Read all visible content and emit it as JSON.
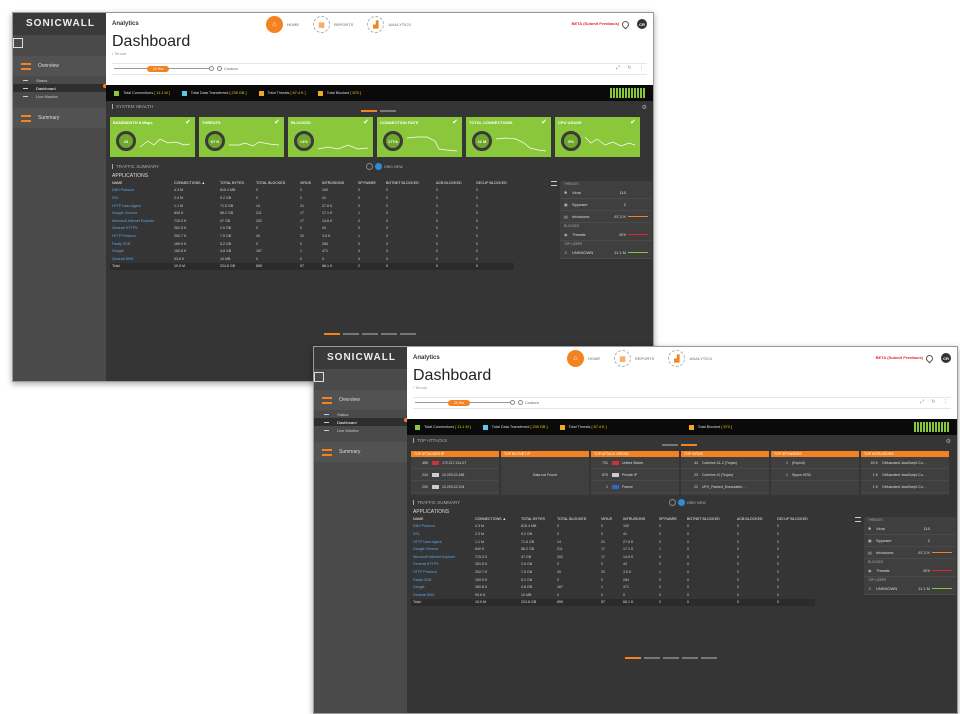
{
  "app": {
    "logo": "SONICWALL",
    "section": "Analytics",
    "title": "Dashboard",
    "breadcrumb": "/ Tenure",
    "beta": "BETA (Submit Feedback)",
    "avatar": "CR"
  },
  "tabs": [
    {
      "label": "HOME"
    },
    {
      "label": "REPORTS"
    },
    {
      "label": "ANALYTICS"
    }
  ],
  "sidebar": {
    "overview": "Overview",
    "status": "Status",
    "dashboard": "Dashboard",
    "livemonitor": "Live Monitor",
    "summary": "Summary"
  },
  "timeline": {
    "selected": "24 Hrs",
    "custom": "Custom"
  },
  "stats": [
    {
      "label": "Total Connections",
      "value": "[ 11.1 M ]",
      "color": "#8ac73a"
    },
    {
      "label": "Total Data Transferred",
      "value": "[ 239 GB ]",
      "color": "#5ec8e5"
    },
    {
      "label": "Total Threats",
      "value": "[ 67.4 K ]",
      "color": "#f5a623"
    },
    {
      "label": "Total Blocked",
      "value": "[ 870 ]",
      "color": "#f5a623"
    }
  ],
  "health": {
    "title": "SYSTEM HEALTH",
    "cards": [
      {
        "name": "BANDWIDTH 8 Mbps",
        "value": "23"
      },
      {
        "name": "THREATS",
        "value": "67 K"
      },
      {
        "name": "BLOCKED",
        "value": "<1%"
      },
      {
        "name": "CONNECTION RATE",
        "value": "177/s"
      },
      {
        "name": "TOTAL CONNECTIONS",
        "value": "11 M"
      },
      {
        "name": "CPU USAGE",
        "value": "9%"
      }
    ]
  },
  "attacks": {
    "title": "TOP ATTACKS",
    "cards": [
      {
        "name": "TOP ATTACKER IP",
        "rows": [
          {
            "n": "455",
            "t": "172.217.214.97"
          },
          {
            "n": "224",
            "t": "10.203.22.186"
          },
          {
            "n": "209",
            "t": "10.203.22.104"
          }
        ]
      },
      {
        "name": "TOP BOTNET IP",
        "empty": "Data not Found"
      },
      {
        "name": "TOP ATTACK ORIGIN",
        "rows": [
          {
            "n": "731",
            "t": "United States"
          },
          {
            "n": "870",
            "t": "Private IP"
          },
          {
            "n": "1",
            "t": "France"
          }
        ]
      },
      {
        "name": "TOP VIRUS",
        "rows": [
          {
            "n": "44",
            "t": "Coinhive.XL.2 (Trojan)"
          },
          {
            "n": "23",
            "t": "Coinhive.XI (Trojan)"
          },
          {
            "n": "22",
            "t": "UPX_Packed_Executable..."
          }
        ]
      },
      {
        "name": "TOP SPYWARES",
        "rows": [
          {
            "n": "1",
            "t": "(Exploit)"
          },
          {
            "n": "1",
            "t": "Spyon ISSD"
          }
        ]
      },
      {
        "name": "TOP INTRUSIONS",
        "rows": [
          {
            "n": "63 K",
            "t": "Obfuscated JavaScript Co..."
          },
          {
            "n": "1 K",
            "t": "Obfuscated JavaScript Co..."
          },
          {
            "n": "1 K",
            "t": "Obfuscated JavaScript Co..."
          }
        ]
      }
    ]
  },
  "traffic": {
    "title": "TRAFFIC SUMMARY",
    "apps_label": "APPLICATIONS",
    "grid_view": "GRID VIEW",
    "headers": [
      "NAME",
      "CONNECTIONS ▲",
      "TOTAL BYTES",
      "TOTAL BLOCKED",
      "VIRUS",
      "INTRUSIONS",
      "SPYWARE",
      "BOTNET BLOCKED",
      "ACB BLOCKED",
      "GEO-IP BLOCKED"
    ],
    "rows": [
      [
        "DNS Protocol",
        "4.3 M",
        "815.4 MB",
        "0",
        "0",
        "100",
        "0",
        "0",
        "0",
        "0"
      ],
      [
        "SSL",
        "2.0 M",
        "9.2 GB",
        "0",
        "0",
        "41",
        "0",
        "0",
        "0",
        "0"
      ],
      [
        "HTTP User-Agent",
        "1.1 M",
        "71.5 GB",
        "14",
        "21",
        "27.8 K",
        "0",
        "0",
        "0",
        "0"
      ],
      [
        "Google Chrome",
        "840 K",
        "56.2 GB",
        "211",
        "17",
        "17.1 K",
        "1",
        "0",
        "0",
        "0"
      ],
      [
        "Microsoft Internet Explorer",
        "715.3 K",
        "47 GB",
        "202",
        "17",
        "14.6 K",
        "0",
        "0",
        "0",
        "0"
      ],
      [
        "General HTTPS",
        "281.5 K",
        "2.6 GB",
        "0",
        "0",
        "44",
        "0",
        "0",
        "0",
        "0"
      ],
      [
        "HTTP Protocol",
        "252.7 K",
        "7.5 GB",
        "40",
        "20",
        "3.5 K",
        "1",
        "0",
        "0",
        "0"
      ],
      [
        "Fastly CDN",
        "169.9 K",
        "5.2 GB",
        "0",
        "0",
        "284",
        "0",
        "0",
        "0",
        "0"
      ],
      [
        "Google",
        "160.8 K",
        "4.8 GB",
        "167",
        "1",
        "471",
        "0",
        "0",
        "0",
        "0"
      ],
      [
        "General DNS",
        "93.6 K",
        "10 MB",
        "0",
        "0",
        "0",
        "0",
        "0",
        "0",
        "0"
      ]
    ],
    "total": [
      "Total",
      "10.9 M",
      "224.6 GB",
      "659",
      "97",
      "66.1 K",
      "2",
      "0",
      "0",
      "0"
    ]
  },
  "rightpanel": {
    "threats_head": "THREATS",
    "virus": "Virus",
    "virus_val": "110",
    "spyware": "Spyware",
    "spyware_val": "2",
    "intrusions": "Intrusions",
    "intrusions_val": "67.2 K",
    "blocked_head": "BLOCKED",
    "threats": "Threats",
    "threats_val": "870",
    "users_head": "TOP USERS",
    "unknown": "UNKNOWN",
    "unknown_val": "11.1 M"
  },
  "colors": {
    "accent": "#f58220",
    "green": "#8ac73a",
    "red": "#e3262a",
    "link": "#5aaaf0"
  }
}
